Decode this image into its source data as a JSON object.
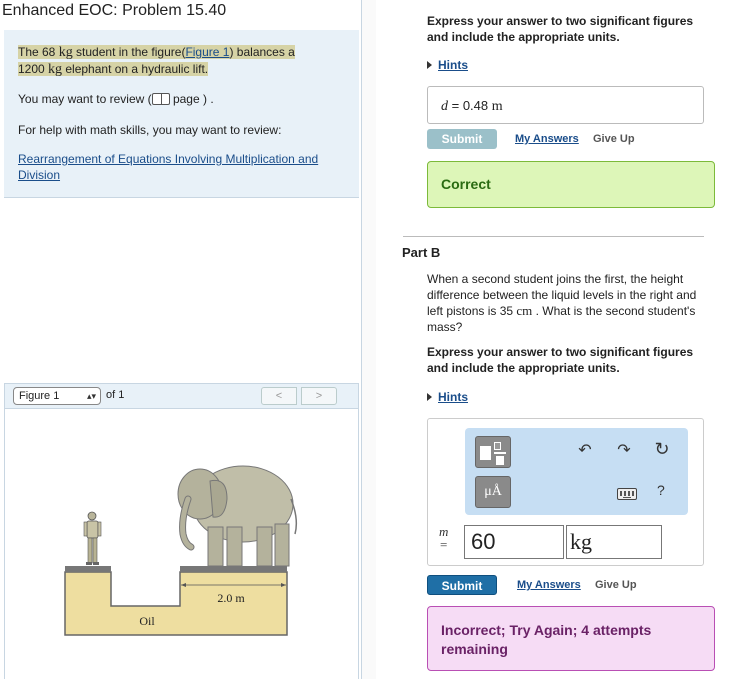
{
  "left": {
    "title": "Enhanced EOC: Problem 15.40",
    "statement": {
      "pre": "The 68 ",
      "unit1": "kg",
      "mid": " student in the figure(",
      "figure_link": "Figure 1",
      "post": ") balances a",
      "line2_num": "1200 ",
      "unit2": "kg",
      "line2_post": " elephant on a hydraulic lift."
    },
    "review": {
      "pre": "You may want to review (",
      "page": " page ) ."
    },
    "help_text": "For help with math skills, you may want to review:",
    "help_link": "Rearrangement of Equations Involving Multiplication and Division"
  },
  "figure": {
    "selected": "Figure 1",
    "of_label": "of 1",
    "prev": "<",
    "next": ">",
    "dimension_label": "2.0 m",
    "liquid_label": "Oil"
  },
  "part_a": {
    "instructions": "Express your answer to two significant figures and include the appropriate units.",
    "hints": "Hints",
    "answer_var": "d",
    "answer_eq": " = ",
    "answer_value": "0.48 ",
    "answer_unit": "m",
    "submit": "Submit",
    "my_answers": "My Answers",
    "give_up": "Give Up",
    "result": "Correct"
  },
  "part_b": {
    "title": "Part B",
    "question_pre": "When a second student joins the first, the height difference between the liquid levels in the right and left pistons is 35 ",
    "question_unit": "cm",
    "question_post": " . What is the second student's mass?",
    "instructions": "Express your answer to two significant figures and include the appropriate units.",
    "hints": "Hints",
    "var": "m",
    "eq": "=",
    "value": "60",
    "unit": "kg",
    "units_button": "μÅ",
    "submit": "Submit",
    "my_answers": "My Answers",
    "give_up": "Give Up",
    "result": "Incorrect; Try Again; 4 attempts remaining"
  },
  "colors": {
    "panel_bg": "#e8f1f8",
    "correct_bg": "#ddf6b8",
    "incorrect_bg": "#f6dcf5",
    "submit_active": "#1f6fa6",
    "oil": "#eedea0"
  }
}
